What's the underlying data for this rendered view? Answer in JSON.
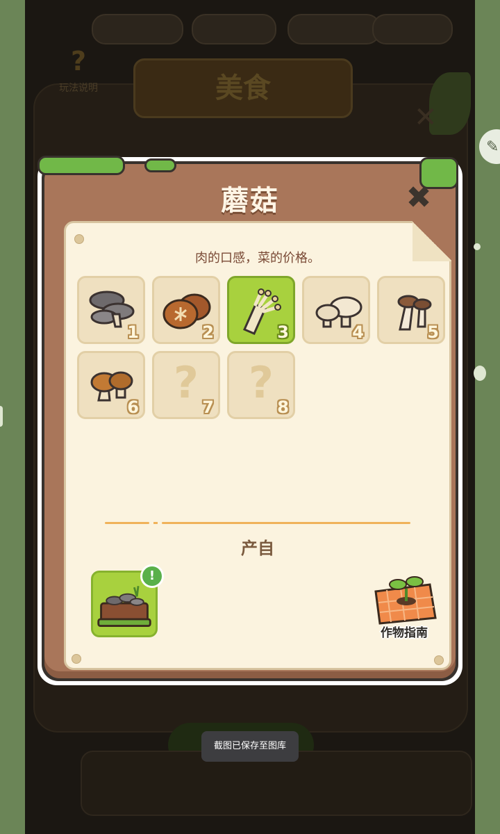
{
  "background": {
    "title": "美食",
    "help_label": "玩法说明",
    "help_mark": "?"
  },
  "dialog": {
    "title": "蘑菇",
    "close_icon": "✖",
    "description": "肉的口感，菜的价格。",
    "items": [
      {
        "number": "1",
        "icon": "oyster-mushroom-icon",
        "discovered": true
      },
      {
        "number": "2",
        "icon": "shiitake-mushroom-icon",
        "discovered": true
      },
      {
        "number": "3",
        "icon": "enoki-mushroom-icon",
        "discovered": true,
        "selected": true
      },
      {
        "number": "4",
        "icon": "white-button-mushroom-icon",
        "discovered": true
      },
      {
        "number": "5",
        "icon": "king-oyster-mushroom-icon",
        "discovered": true
      },
      {
        "number": "6",
        "icon": "porcini-mushroom-icon",
        "discovered": true
      },
      {
        "number": "7",
        "icon": "unknown-icon",
        "discovered": false,
        "placeholder": "?"
      },
      {
        "number": "8",
        "icon": "unknown-icon",
        "discovered": false,
        "placeholder": "?"
      }
    ],
    "source_label": "产自",
    "source_badge": "!",
    "guide_label": "作物指南"
  },
  "toast": "截图已保存至图库"
}
